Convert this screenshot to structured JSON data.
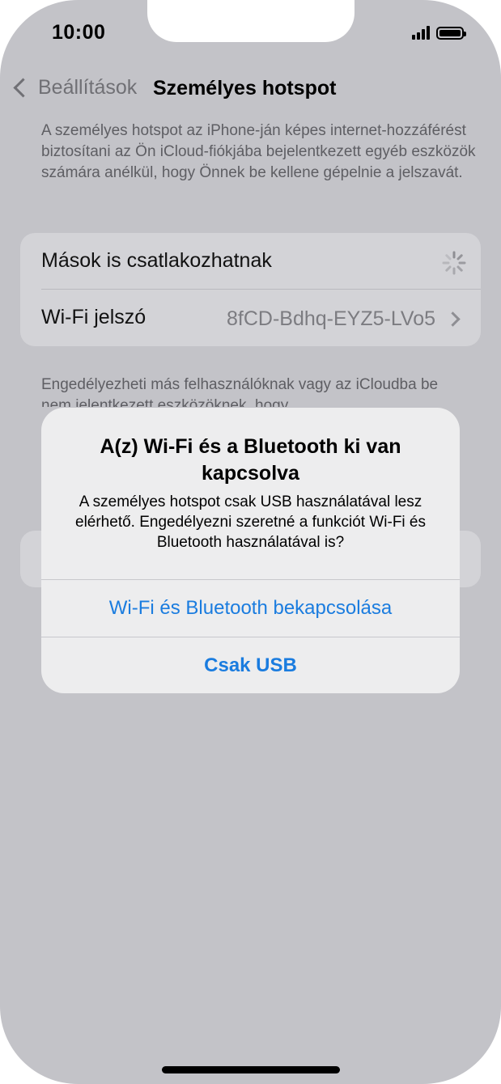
{
  "status": {
    "time": "10:00"
  },
  "nav": {
    "back_label": "Beállítások",
    "title": "Személyes hotspot"
  },
  "description": "A személyes hotspot az iPhone-ján képes internet-hozzáférést biztosítani az Ön iCloud-fiókjába bejelentkezett egyéb eszközök számára anélkül, hogy Önnek be kellene gépelnie a jelszavát.",
  "settings": {
    "allow_others_label": "Mások is csatlakozhatnak",
    "wifi_password_label": "Wi-Fi jelszó",
    "wifi_password_value": "8fCD-Bdhq-EYZ5-LVo5"
  },
  "footer_text": "Engedélyezheti más felhasználóknak vagy az iCloudba be nem jelentkezett eszközöknek, hogy",
  "alert": {
    "title": "A(z) Wi-Fi és a Bluetooth ki van kapcsolva",
    "message": "A személyes hotspot csak USB használatával lesz elérhető. Engedélyezni szeretné a funkciót Wi-Fi és Bluetooth használatával is?",
    "button_primary": "Wi-Fi és Bluetooth bekapcsolása",
    "button_secondary": "Csak USB"
  },
  "colors": {
    "accent": "#1a7cdf",
    "dim_background": "#c3c3c8"
  }
}
